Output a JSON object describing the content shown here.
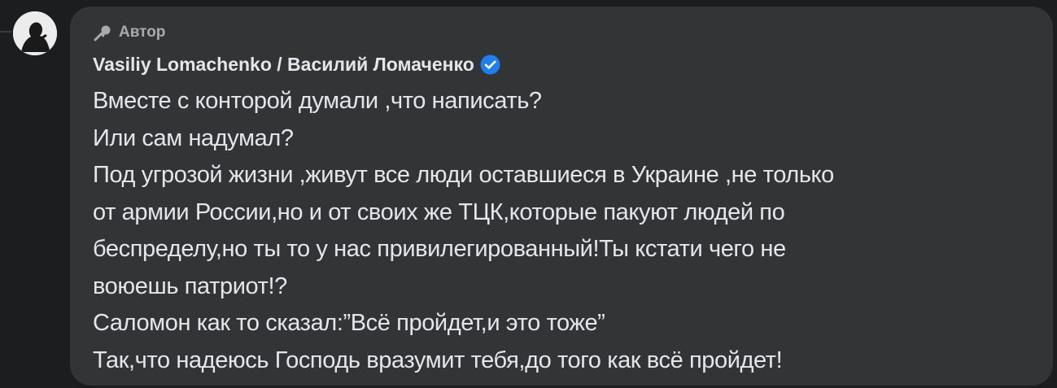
{
  "comment": {
    "author_badge": "Автор",
    "author_name": "Vasiliy Lomachenko / Василий Ломаченко",
    "verified": true,
    "lines": [
      "Вместе с конторой думали ,что написать?",
      "Или сам надумал?",
      "Под угрозой жизни ,живут все люди оставшиеся в Украине ,не только",
      "от армии России,но и от своих же ТЦК,которые пакуют людей по",
      "беспределу,но ты то у нас привилегированный!Ты кстати чего не",
      "воюешь патриот!?",
      "Саломон как то сказал:”Всё пройдет,и это тоже”",
      "Так,что надеюсь Господь вразумит тебя,до того как всё пройдет!"
    ]
  },
  "icons": {
    "author_badge_icon": "microphone-icon",
    "verified_icon": "verified-badge-icon",
    "avatar": "avatar-icon"
  },
  "colors": {
    "background": "#1c1d1f",
    "bubble": "#333436",
    "text_primary": "#e4e6eb",
    "text_secondary": "#a9abaf",
    "verified_blue": "#1d7ff0"
  }
}
